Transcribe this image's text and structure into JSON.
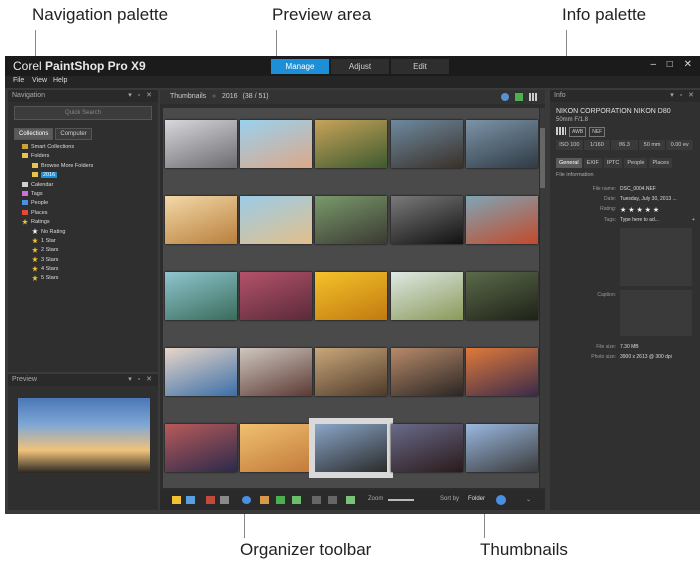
{
  "callouts": {
    "navigation_palette": "Navigation palette",
    "preview_area": "Preview area",
    "info_palette": "Info palette",
    "organizer_toolbar": "Organizer toolbar",
    "thumbnails": "Thumbnails"
  },
  "app": {
    "title_prefix": "Corel ",
    "title_main": "PaintShop Pro X9",
    "window_controls": "– □ ✕",
    "modes": [
      "Manage",
      "Adjust",
      "Edit"
    ],
    "menu": [
      "File",
      "View",
      "Help"
    ]
  },
  "navigation": {
    "header": "Navigation",
    "search_placeholder": "Quick Search",
    "tabs": [
      "Collections",
      "Computer"
    ],
    "tree": [
      {
        "label": "Smart Collections",
        "icon": "smart-collections-icon",
        "color": "#c9a23a"
      },
      {
        "label": "Folders",
        "icon": "folder-icon",
        "color": "#e8c24a"
      },
      {
        "label": "Browse More Folders",
        "icon": "folder-icon",
        "color": "#e8c24a"
      },
      {
        "label": "2016",
        "icon": "folder-icon",
        "color": "#e8c24a",
        "selected": true
      },
      {
        "label": "Calendar",
        "icon": "calendar-icon",
        "color": "#d0d0d0"
      },
      {
        "label": "Tags",
        "icon": "tag-icon",
        "color": "#d06fd6"
      },
      {
        "label": "People",
        "icon": "people-icon",
        "color": "#4a90e2"
      },
      {
        "label": "Places",
        "icon": "places-icon",
        "color": "#e04a3a"
      },
      {
        "label": "Ratings",
        "icon": "star-icon",
        "color": "#f2c230"
      },
      {
        "label": "No Rating",
        "icon": "star-icon",
        "color": "#f2f2f2"
      },
      {
        "label": "1 Star",
        "icon": "star-icon",
        "color": "#f2c230"
      },
      {
        "label": "2 Stars",
        "icon": "star-icon",
        "color": "#f2c230"
      },
      {
        "label": "3 Stars",
        "icon": "star-icon",
        "color": "#f2c230"
      },
      {
        "label": "4 Stars",
        "icon": "star-icon",
        "color": "#f2c230"
      },
      {
        "label": "5 Stars",
        "icon": "star-icon",
        "color": "#f2c230"
      }
    ]
  },
  "preview": {
    "header": "Preview"
  },
  "center": {
    "breadcrumb_root": "Thumbnails",
    "breadcrumb_sep": "»",
    "breadcrumb_folder": "2016",
    "breadcrumb_count": "(38 / 51)"
  },
  "thumbnails": [
    {
      "name": "dog-on-bed",
      "colors": [
        "#d8d8dc",
        "#6b6b70"
      ]
    },
    {
      "name": "child-with-arms-wide",
      "colors": [
        "#9ad1ef",
        "#dca888"
      ]
    },
    {
      "name": "forest-light",
      "colors": [
        "#c7a35a",
        "#3d5a2e"
      ]
    },
    {
      "name": "rocky-landscape",
      "colors": [
        "#6d8aa0",
        "#3a3028"
      ]
    },
    {
      "name": "industrial-workers",
      "colors": [
        "#7c94a8",
        "#2f3a44"
      ]
    },
    {
      "name": "children-field-sunset",
      "colors": [
        "#f2d9a8",
        "#b97f3c"
      ]
    },
    {
      "name": "girl-sun-hat",
      "colors": [
        "#9bcbe8",
        "#e2c08a"
      ]
    },
    {
      "name": "hands-smartphone",
      "colors": [
        "#7a9a6b",
        "#3a3a32"
      ]
    },
    {
      "name": "car-wheel",
      "colors": [
        "#7a7a7a",
        "#111111"
      ]
    },
    {
      "name": "people-in-boat",
      "colors": [
        "#7fa5b6",
        "#c24a2b"
      ]
    },
    {
      "name": "tropical-beach",
      "colors": [
        "#8fc6cf",
        "#3a6b5a"
      ]
    },
    {
      "name": "women-with-bike",
      "colors": [
        "#b4526a",
        "#5a2a3a"
      ]
    },
    {
      "name": "yellow-flower",
      "colors": [
        "#f4c22a",
        "#c27a10"
      ]
    },
    {
      "name": "jumping-boy",
      "colors": [
        "#dfe8e4",
        "#8a9a5a"
      ]
    },
    {
      "name": "camera-on-pier",
      "colors": [
        "#5a6a4a",
        "#1f2218"
      ]
    },
    {
      "name": "baby-winter-hat",
      "colors": [
        "#e8d6c8",
        "#3b6fa8"
      ]
    },
    {
      "name": "woman-on-laptop",
      "colors": [
        "#cfc7c0",
        "#5b3a33"
      ]
    },
    {
      "name": "photos-on-table",
      "colors": [
        "#c9a77a",
        "#4e3a2a"
      ]
    },
    {
      "name": "person-with-camera",
      "colors": [
        "#b88a6a",
        "#2a2624"
      ]
    },
    {
      "name": "sunset-over-water",
      "colors": [
        "#e07a3a",
        "#3a2a4a"
      ]
    },
    {
      "name": "sunset-clouds",
      "colors": [
        "#b85a5a",
        "#2a2a4a"
      ]
    },
    {
      "name": "kids-smiling",
      "colors": [
        "#f0c070",
        "#c27a3a"
      ]
    },
    {
      "name": "field-sunset-selected",
      "colors": [
        "#8aa6c8",
        "#2b2b2b"
      ],
      "selected": true
    },
    {
      "name": "pier-sunset",
      "colors": [
        "#6a6a8a",
        "#2a1a1a"
      ]
    },
    {
      "name": "sky-sunset",
      "colors": [
        "#9ab8e0",
        "#3a3a3a"
      ]
    }
  ],
  "toolbar": {
    "zoom_label": "Zoom",
    "sort_label": "Sort by",
    "sort_value": "Folder"
  },
  "info": {
    "header": "Info",
    "camera": "NIKON CORPORATION NIKON D80",
    "lens": "50mm F/1.8",
    "badges": [
      "AWB",
      "NEF"
    ],
    "exif": [
      "ISO 100",
      "1/160",
      "f/6.3",
      "50 mm",
      "0.00 ev"
    ],
    "tabs": [
      "General",
      "EXIF",
      "IPTC",
      "People",
      "Places"
    ],
    "section": "File information",
    "fields": {
      "file_name_label": "File name:",
      "file_name": "DSC_0004.NEF",
      "date_label": "Date:",
      "date": "Tuesday, July 30, 2013 ...",
      "rating_label": "Rating:",
      "rating": "★ ★ ★ ★ ★",
      "tags_label": "Tags:",
      "tags_placeholder": "Type here to ad...",
      "caption_label": "Caption:",
      "file_size_label": "File size:",
      "file_size": "7.30 MB",
      "photo_size_label": "Photo size:",
      "photo_size": "3900 x 2613 @ 300 dpi"
    }
  }
}
